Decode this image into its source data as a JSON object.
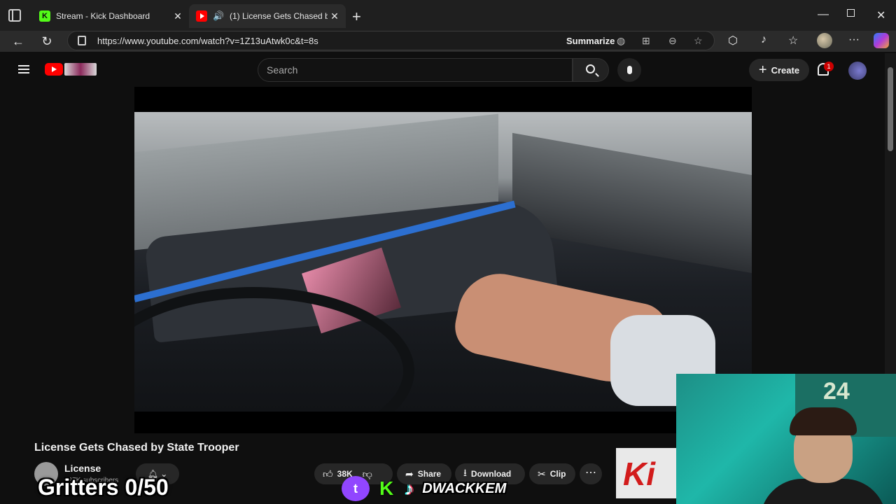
{
  "browser": {
    "tabs": [
      {
        "title": "Stream - Kick Dashboard",
        "icon": "kick-icon"
      },
      {
        "title": "(1) License Gets Chased by S",
        "icon": "youtube-icon",
        "audio": "speaker-icon",
        "active": true
      }
    ],
    "url": "https://www.youtube.com/watch?v=1Z13uAtwk0c&t=8s",
    "summarize_label": "Summarize",
    "new_tab": "+",
    "close_glyph": "✕"
  },
  "youtube": {
    "search_placeholder": "Search",
    "create_label": "Create",
    "notification_count": "1"
  },
  "video": {
    "title": "License Gets Chased by State Trooper",
    "channel_name": "License",
    "subscribers": "997K subscribers",
    "likes": "38K",
    "share_label": "Share",
    "download_label": "Download",
    "clip_label": "Clip"
  },
  "overlay": {
    "gritters": "Gritters 0/50",
    "handle": "DWACKKEM",
    "jersey_number": "24",
    "kick_glyph": "K",
    "twitch_glyph": "t",
    "tiktok_glyph": "♪",
    "ad_text": "Ki"
  },
  "colors": {
    "youtube_red": "#ff0000",
    "kick_green": "#53fc18",
    "twitch_purple": "#9146ff"
  }
}
